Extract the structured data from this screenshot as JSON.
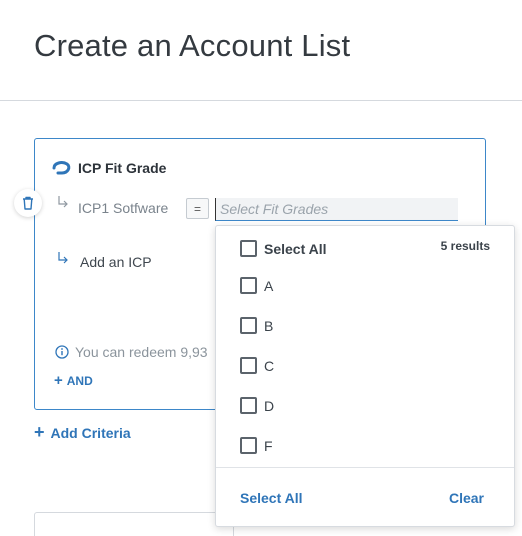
{
  "page": {
    "title": "Create an Account List"
  },
  "criteria_card": {
    "title": "ICP Fit Grade",
    "criterion_label": "ICP1 Sotfware",
    "operator": "=",
    "fit_grade_placeholder": "Select Fit Grades",
    "add_icp_label": "Add an ICP",
    "redeem_text": "You can redeem 9,93",
    "and_label": "AND"
  },
  "add_criteria_label": "Add Criteria",
  "dropdown": {
    "select_all_label": "Select All",
    "results_count": "5 results",
    "options": [
      "A",
      "B",
      "C",
      "D",
      "F"
    ],
    "footer_select_all": "Select All",
    "footer_clear": "Clear"
  },
  "colors": {
    "accent": "#2f75b8",
    "focus_border": "#3d87c9"
  },
  "icons": {
    "logo": "brand-swirl-icon",
    "delete": "trash-icon",
    "branch": "branch-arrow-icon",
    "info": "info-icon"
  }
}
